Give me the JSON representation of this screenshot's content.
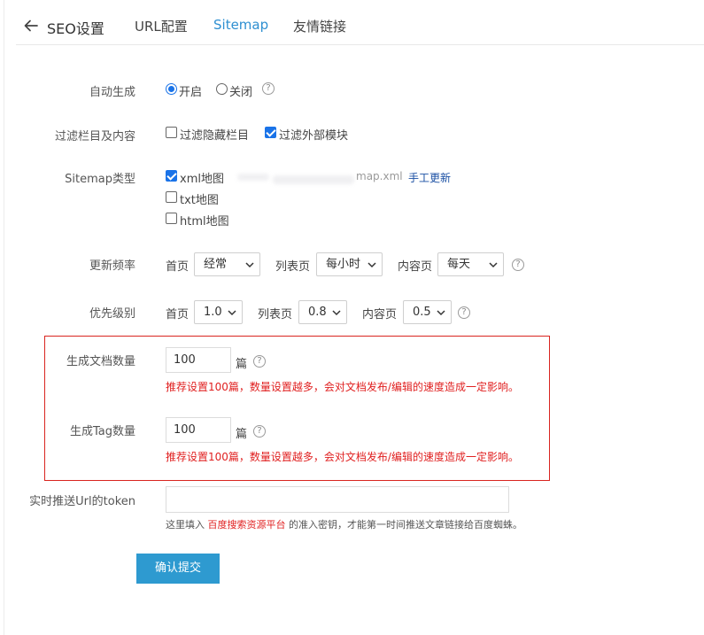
{
  "header": {
    "title": "SEO设置",
    "tabs": [
      {
        "label": "URL配置"
      },
      {
        "label": "Sitemap"
      },
      {
        "label": "友情链接"
      }
    ]
  },
  "auto_generate": {
    "label": "自动生成",
    "on_label": "开启",
    "off_label": "关闭",
    "value": "开启"
  },
  "filter": {
    "label": "过滤栏目及内容",
    "opt_hidden": "过滤隐藏栏目",
    "opt_external": "过滤外部模块",
    "hidden_checked": false,
    "external_checked": true
  },
  "sitemap_type": {
    "label": "Sitemap类型",
    "xml_label": "xml地图",
    "xml_url_visible_end": "map.xml",
    "manual_update": "手工更新",
    "txt_label": "txt地图",
    "html_label": "html地图",
    "xml_checked": true,
    "txt_checked": false,
    "html_checked": false
  },
  "frequency": {
    "label": "更新频率",
    "home_label": "首页",
    "home_value": "经常",
    "list_label": "列表页",
    "list_value": "每小时",
    "content_label": "内容页",
    "content_value": "每天"
  },
  "priority": {
    "label": "优先级别",
    "home_label": "首页",
    "home_value": "1.0",
    "list_label": "列表页",
    "list_value": "0.8",
    "content_label": "内容页",
    "content_value": "0.5"
  },
  "doc_count": {
    "label": "生成文档数量",
    "value": "100",
    "unit": "篇",
    "warning": "推荐设置100篇，数量设置越多，会对文档发布/编辑的速度造成一定影响。"
  },
  "tag_count": {
    "label": "生成Tag数量",
    "value": "100",
    "unit": "篇",
    "warning": "推荐设置100篇，数量设置越多，会对文档发布/编辑的速度造成一定影响。"
  },
  "token": {
    "label": "实时推送Url的token",
    "value": "",
    "hint_pre": "这里填入",
    "hint_link": "百度搜索资源平台",
    "hint_post": "的准入密钥，才能第一时间推送文章链接给百度蜘蛛。"
  },
  "submit_label": "确认提交",
  "colors": {
    "accent": "#2e8fd1",
    "button": "#2e9ad0",
    "warning": "#e02020",
    "box_border": "#d9241f"
  },
  "icons": {
    "back": "arrow-left-icon",
    "help": "question-circle-icon",
    "dropdown": "chevron-down-icon"
  }
}
